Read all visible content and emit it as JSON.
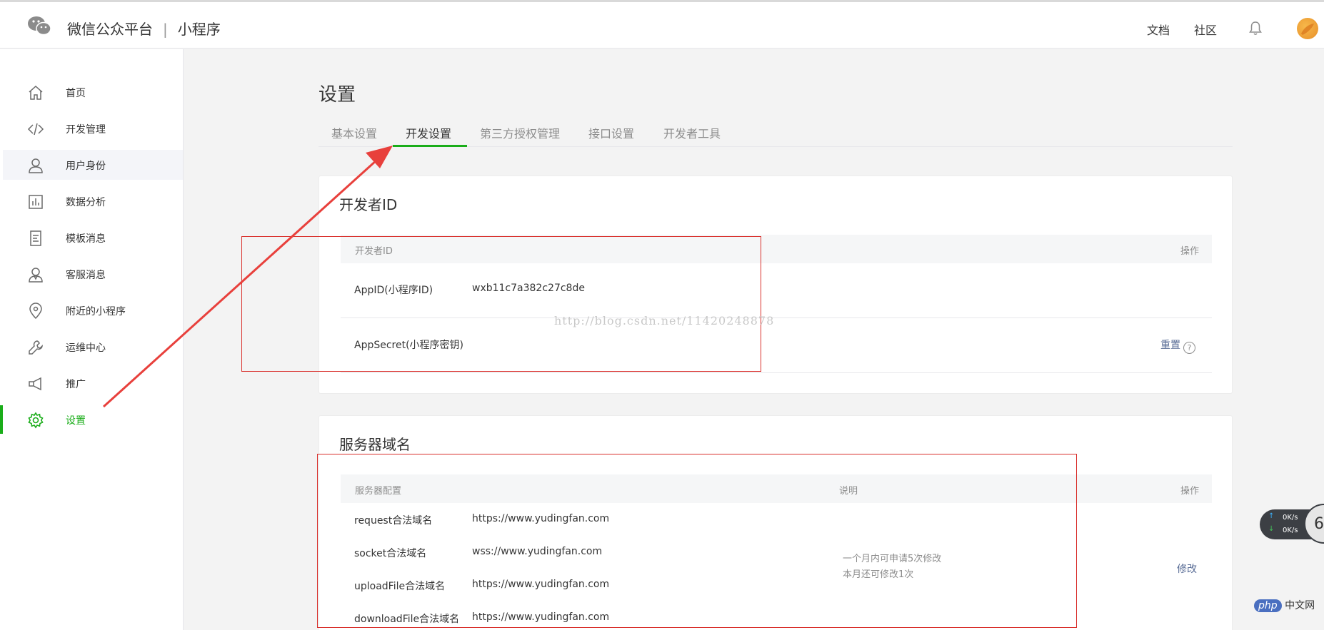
{
  "header": {
    "brand": "微信公众平台",
    "separator": "|",
    "product": "小程序",
    "links": {
      "docs": "文档",
      "community": "社区"
    }
  },
  "sidebar": {
    "items": [
      {
        "label": "首页",
        "icon": "home-icon"
      },
      {
        "label": "开发管理",
        "icon": "code-icon"
      },
      {
        "label": "用户身份",
        "icon": "user-icon"
      },
      {
        "label": "数据分析",
        "icon": "chart-icon"
      },
      {
        "label": "模板消息",
        "icon": "document-icon"
      },
      {
        "label": "客服消息",
        "icon": "customer-service-icon"
      },
      {
        "label": "附近的小程序",
        "icon": "location-pin-icon"
      },
      {
        "label": "运维中心",
        "icon": "wrench-icon"
      },
      {
        "label": "推广",
        "icon": "megaphone-icon"
      },
      {
        "label": "设置",
        "icon": "gear-icon"
      }
    ],
    "active": "设置"
  },
  "main": {
    "title": "设置",
    "tabs": [
      "基本设置",
      "开发设置",
      "第三方授权管理",
      "接口设置",
      "开发者工具"
    ],
    "active_tab": "开发设置",
    "developer": {
      "title": "开发者ID",
      "col_id": "开发者ID",
      "col_action": "操作",
      "appid_label": "AppID(小程序ID)",
      "appid_value": "wxb11c7a382c27c8de",
      "secret_label": "AppSecret(小程序密钥)",
      "reset": "重置",
      "help": "?"
    },
    "server": {
      "title": "服务器域名",
      "col_config": "服务器配置",
      "col_desc": "说明",
      "col_action": "操作",
      "rows": [
        {
          "label": "request合法域名",
          "value": "https://www.yudingfan.com"
        },
        {
          "label": "socket合法域名",
          "value": "wss://www.yudingfan.com"
        },
        {
          "label": "uploadFile合法域名",
          "value": "https://www.yudingfan.com"
        },
        {
          "label": "downloadFile合法域名",
          "value": "https://www.yudingfan.com"
        }
      ],
      "note_line1": "一个月内可申请5次修改",
      "note_line2": "本月还可修改1次",
      "modify": "修改"
    }
  },
  "overlay": {
    "watermark": "http://blog.csdn.net/11420248878",
    "speed_up": "0K/s",
    "speed_down": "0K/s",
    "bubble_number": "6",
    "php_badge": "php",
    "php_site": "中文网"
  },
  "colors": {
    "accent": "#1aad19",
    "link": "#576b95",
    "annotation": "#d9302c"
  }
}
